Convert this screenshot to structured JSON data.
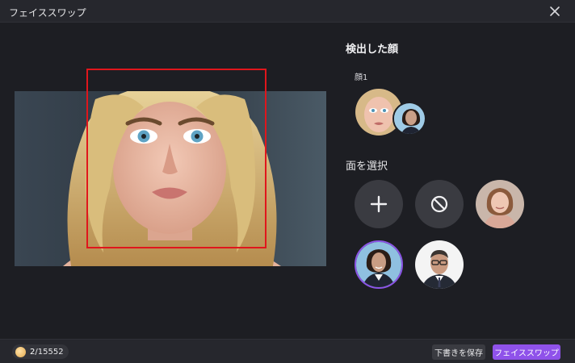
{
  "window": {
    "title": "フェイススワップ"
  },
  "preview": {
    "image_icon": "portrait-blonde-woman"
  },
  "detected": {
    "heading": "検出した顔",
    "face_label": "顔1",
    "source_icon": "detected-face-blonde",
    "target_icon": "selected-face-woman-suit"
  },
  "select": {
    "heading": "面を選択",
    "options": [
      {
        "icon": "plus-icon"
      },
      {
        "icon": "no-entry-icon"
      },
      {
        "icon": "face-young-woman"
      },
      {
        "icon": "face-woman-suit",
        "selected": true
      },
      {
        "icon": "face-man-glasses-suit"
      }
    ]
  },
  "footer": {
    "credits_used": "2",
    "credits_total": "/15552",
    "save_label": "下書きを保存",
    "swap_label": "フェイススワップ"
  },
  "colors": {
    "accent": "#8f52ea",
    "face_box": "#e0161c"
  }
}
